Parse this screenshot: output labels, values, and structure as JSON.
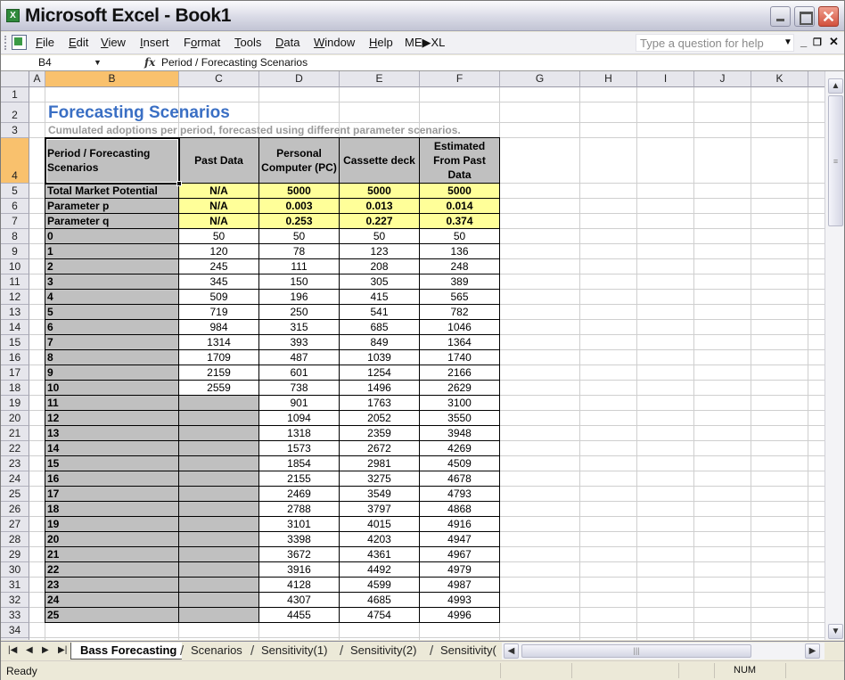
{
  "window": {
    "title": "Microsoft Excel - Book1",
    "app_icon": "excel-icon",
    "controls": {
      "minimize": "minimize",
      "maximize": "maximize",
      "close": "✕"
    }
  },
  "menubar": {
    "items": [
      {
        "label": "File",
        "accel": "F"
      },
      {
        "label": "Edit",
        "accel": "E"
      },
      {
        "label": "View",
        "accel": "V"
      },
      {
        "label": "Insert",
        "accel": "I"
      },
      {
        "label": "Format",
        "accel": "o"
      },
      {
        "label": "Tools",
        "accel": "T"
      },
      {
        "label": "Data",
        "accel": "D"
      },
      {
        "label": "Window",
        "accel": "W"
      },
      {
        "label": "Help",
        "accel": "H"
      },
      {
        "label": "ME▶XL",
        "accel": ""
      }
    ],
    "help_placeholder": "Type a question for help",
    "mdi_min": "_",
    "mdi_restore": "❐",
    "mdi_close": "✕"
  },
  "formulabar": {
    "name_box": "B4",
    "fx_label": "fx",
    "formula": "Period / Forecasting Scenarios"
  },
  "columns": [
    "A",
    "B",
    "C",
    "D",
    "E",
    "F",
    "G",
    "H",
    "I",
    "J",
    "K"
  ],
  "selected_column": "B",
  "selected_row": 4,
  "row_numbers": [
    1,
    2,
    3,
    4,
    5,
    6,
    7,
    8,
    9,
    10,
    11,
    12,
    13,
    14,
    15,
    16,
    17,
    18,
    19,
    20,
    21,
    22,
    23,
    24,
    25,
    26,
    27,
    28,
    29,
    30,
    31,
    32,
    33,
    34
  ],
  "sheet": {
    "title": "Forecasting Scenarios",
    "subtitle": "Cumulated adoptions per period, forecasted using different parameter scenarios.",
    "headers": [
      "Period / Forecasting Scenarios",
      "Past Data",
      "Personal Computer (PC)",
      "Cassette deck",
      "Estimated From Past Data"
    ],
    "param_rows": [
      {
        "label": "Total Market Potential",
        "values": [
          "N/A",
          "5000",
          "5000",
          "5000"
        ]
      },
      {
        "label": "Parameter p",
        "values": [
          "N/A",
          "0.003",
          "0.013",
          "0.014"
        ]
      },
      {
        "label": "Parameter q",
        "values": [
          "N/A",
          "0.253",
          "0.227",
          "0.374"
        ]
      }
    ],
    "period_rows": [
      {
        "period": "0",
        "past": "50",
        "pc": "50",
        "cassette": "50",
        "estimated": "50"
      },
      {
        "period": "1",
        "past": "120",
        "pc": "78",
        "cassette": "123",
        "estimated": "136"
      },
      {
        "period": "2",
        "past": "245",
        "pc": "111",
        "cassette": "208",
        "estimated": "248"
      },
      {
        "period": "3",
        "past": "345",
        "pc": "150",
        "cassette": "305",
        "estimated": "389"
      },
      {
        "period": "4",
        "past": "509",
        "pc": "196",
        "cassette": "415",
        "estimated": "565"
      },
      {
        "period": "5",
        "past": "719",
        "pc": "250",
        "cassette": "541",
        "estimated": "782"
      },
      {
        "period": "6",
        "past": "984",
        "pc": "315",
        "cassette": "685",
        "estimated": "1046"
      },
      {
        "period": "7",
        "past": "1314",
        "pc": "393",
        "cassette": "849",
        "estimated": "1364"
      },
      {
        "period": "8",
        "past": "1709",
        "pc": "487",
        "cassette": "1039",
        "estimated": "1740"
      },
      {
        "period": "9",
        "past": "2159",
        "pc": "601",
        "cassette": "1254",
        "estimated": "2166"
      },
      {
        "period": "10",
        "past": "2559",
        "pc": "738",
        "cassette": "1496",
        "estimated": "2629"
      },
      {
        "period": "11",
        "past": "",
        "pc": "901",
        "cassette": "1763",
        "estimated": "3100"
      },
      {
        "period": "12",
        "past": "",
        "pc": "1094",
        "cassette": "2052",
        "estimated": "3550"
      },
      {
        "period": "13",
        "past": "",
        "pc": "1318",
        "cassette": "2359",
        "estimated": "3948"
      },
      {
        "period": "14",
        "past": "",
        "pc": "1573",
        "cassette": "2672",
        "estimated": "4269"
      },
      {
        "period": "15",
        "past": "",
        "pc": "1854",
        "cassette": "2981",
        "estimated": "4509"
      },
      {
        "period": "16",
        "past": "",
        "pc": "2155",
        "cassette": "3275",
        "estimated": "4678"
      },
      {
        "period": "17",
        "past": "",
        "pc": "2469",
        "cassette": "3549",
        "estimated": "4793"
      },
      {
        "period": "18",
        "past": "",
        "pc": "2788",
        "cassette": "3797",
        "estimated": "4868"
      },
      {
        "period": "19",
        "past": "",
        "pc": "3101",
        "cassette": "4015",
        "estimated": "4916"
      },
      {
        "period": "20",
        "past": "",
        "pc": "3398",
        "cassette": "4203",
        "estimated": "4947"
      },
      {
        "period": "21",
        "past": "",
        "pc": "3672",
        "cassette": "4361",
        "estimated": "4967"
      },
      {
        "period": "22",
        "past": "",
        "pc": "3916",
        "cassette": "4492",
        "estimated": "4979"
      },
      {
        "period": "23",
        "past": "",
        "pc": "4128",
        "cassette": "4599",
        "estimated": "4987"
      },
      {
        "period": "24",
        "past": "",
        "pc": "4307",
        "cassette": "4685",
        "estimated": "4993"
      },
      {
        "period": "25",
        "past": "",
        "pc": "4455",
        "cassette": "4754",
        "estimated": "4996"
      }
    ]
  },
  "colors": {
    "title_blue": "#3a6fc4",
    "subtitle_gray": "#9a9a9a",
    "label_gray": "#c0c0c0",
    "param_yellow": "#ffff99",
    "selection_orange": "#f9c16d"
  },
  "tabs": {
    "nav": [
      "⏮",
      "◀",
      "▶",
      "⏭"
    ],
    "sheets": [
      "Bass Forecasting",
      "Scenarios",
      "Sensitivity(1)",
      "Sensitivity(2)",
      "Sensitivity("
    ],
    "active": "Bass Forecasting"
  },
  "statusbar": {
    "status": "Ready",
    "num_indicator": "NUM"
  }
}
